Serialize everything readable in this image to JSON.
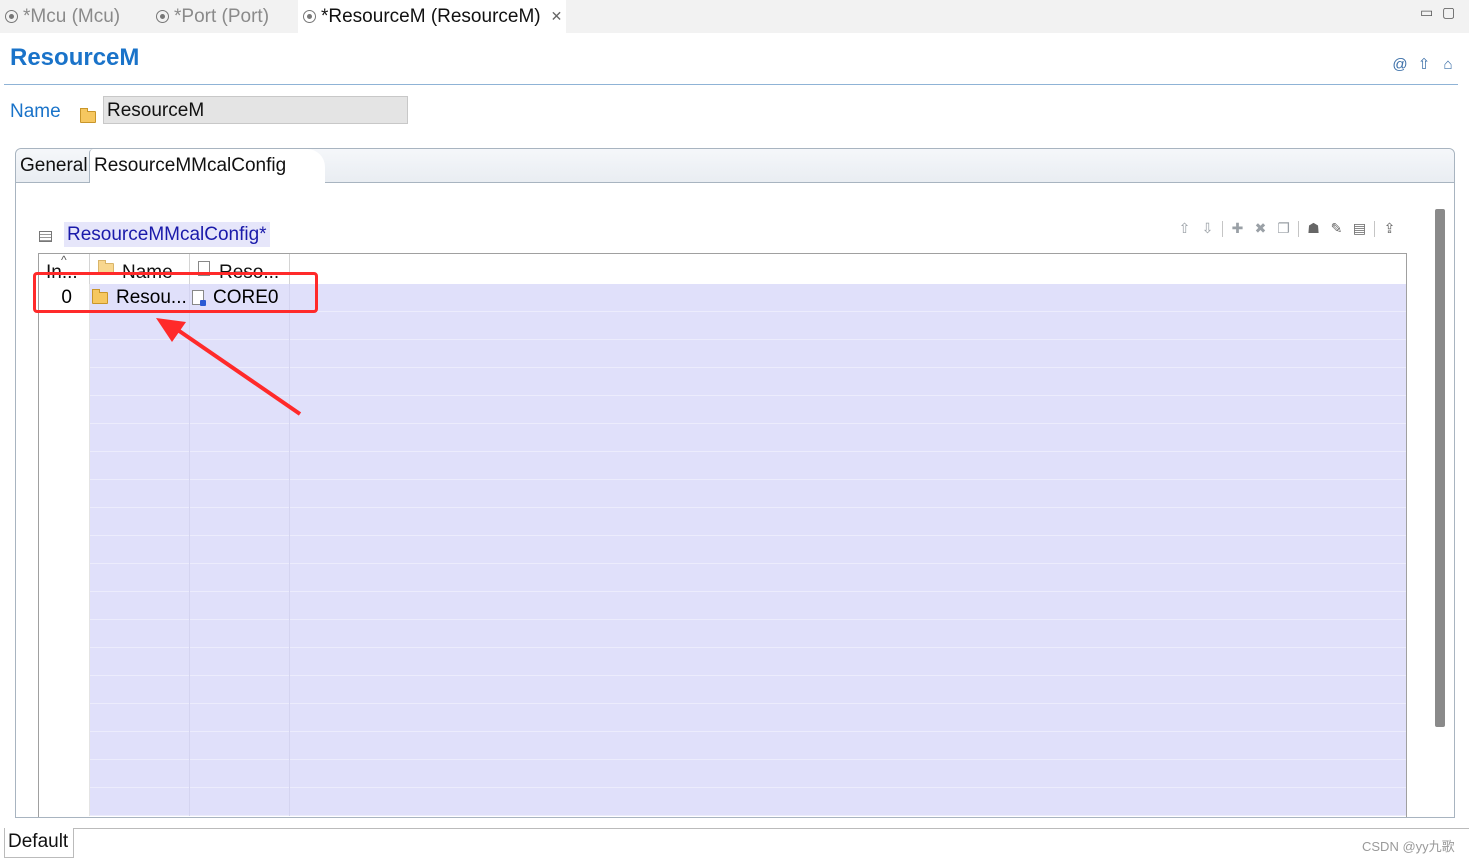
{
  "editor_tabs": [
    {
      "label": "*Mcu (Mcu)",
      "active": false
    },
    {
      "label": "*Port (Port)",
      "active": false
    },
    {
      "label": "*ResourceM (ResourceM)",
      "active": true
    }
  ],
  "window_controls": {
    "minimize": "▭",
    "maximize": "▢"
  },
  "form": {
    "title": "ResourceM",
    "header_icons": [
      "at-icon",
      "up-arrow-icon",
      "home-icon"
    ],
    "name_label": "Name",
    "name_value": "ResourceM"
  },
  "folder_tabs": [
    {
      "label": "General",
      "active": false
    },
    {
      "label": "ResourceMMcalConfig",
      "active": true
    }
  ],
  "section": {
    "title": "ResourceMMcalConfig*",
    "toolbar_icons": [
      "move-up-icon",
      "move-down-icon",
      "add-icon",
      "delete-icon",
      "copy-icon",
      "user-icon",
      "edit-icon",
      "table-edit-icon",
      "import-icon"
    ]
  },
  "table": {
    "columns": [
      {
        "key": "index",
        "label": "In..."
      },
      {
        "key": "name",
        "label": "Name"
      },
      {
        "key": "resource",
        "label": "Reso..."
      }
    ],
    "rows": [
      {
        "index": "0",
        "name": "Resou...",
        "resource": "CORE0"
      }
    ]
  },
  "bottom_tab": "Default",
  "watermark": "CSDN @yy九歌",
  "colors": {
    "accent": "#1a73c9",
    "row_fill": "#e0e0fa",
    "annotation": "#ff2a2a"
  }
}
